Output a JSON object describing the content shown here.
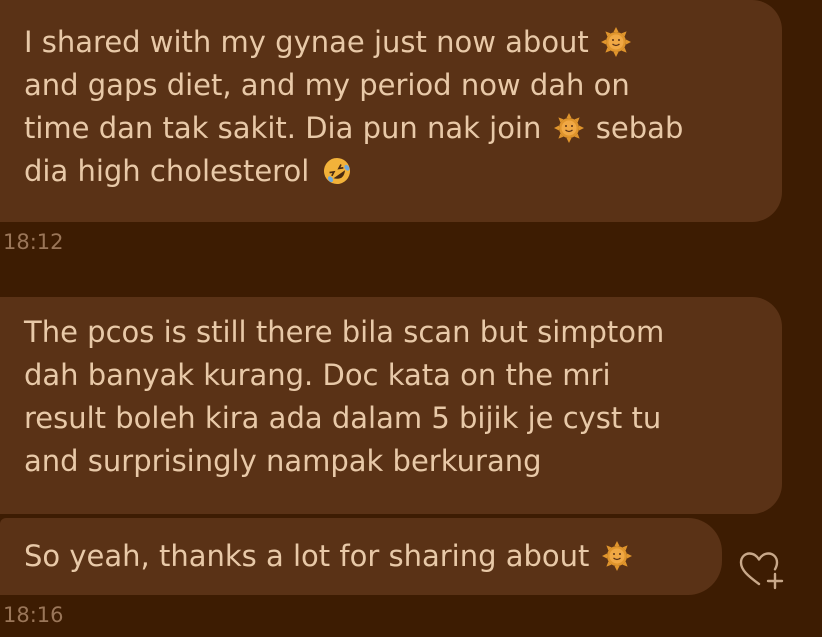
{
  "messages": [
    {
      "lines": [
        [
          "I shared with my gynae just now about ",
          "sun-icon",
          ""
        ],
        [
          "and gaps diet, and my period now dah on"
        ],
        [
          "time dan tak sakit. Dia pun nak join ",
          "sun-icon",
          " sebab"
        ],
        [
          "dia high cholesterol ",
          "rofl-icon",
          ""
        ]
      ],
      "timestamp": "18:12"
    },
    {
      "lines": [
        [
          "The pcos is still there bila scan but simptom"
        ],
        [
          "dah banyak kurang. Doc kata on the mri"
        ],
        [
          "result boleh kira ada dalam 5 bijik je cyst tu"
        ],
        [
          "and surprisingly nampak berkurang"
        ]
      ]
    },
    {
      "lines": [
        [
          "So yeah, thanks a lot for sharing about ",
          "sun-icon",
          ""
        ]
      ],
      "timestamp": "18:16"
    }
  ],
  "text": {
    "m1_l1a": "I shared with my gynae just now about ",
    "m1_l2": "and gaps diet, and my period now dah on",
    "m1_l3a": "time dan tak sakit. Dia pun nak join ",
    "m1_l3b": " sebab",
    "m1_l4a": "dia high cholesterol ",
    "ts1": "18:12",
    "m2_l1": "The pcos is still there bila scan but simptom",
    "m2_l2": "dah banyak kurang. Doc kata on the mri",
    "m2_l3": "result boleh kira ada dalam 5 bijik je cyst tu",
    "m2_l4": "and surprisingly nampak berkurang",
    "m3_l1a": "So yeah, thanks a lot for sharing about ",
    "ts2": "18:16"
  },
  "icons": {
    "sun": "sun-icon",
    "rofl": "rolling-on-floor-laughing-icon",
    "react": "heart-plus-icon"
  },
  "colors": {
    "background": "#3d1c02",
    "bubble": "#5a3216",
    "text": "#e8c9a8",
    "timestamp": "#9a7659",
    "sun": "#e0952c"
  }
}
